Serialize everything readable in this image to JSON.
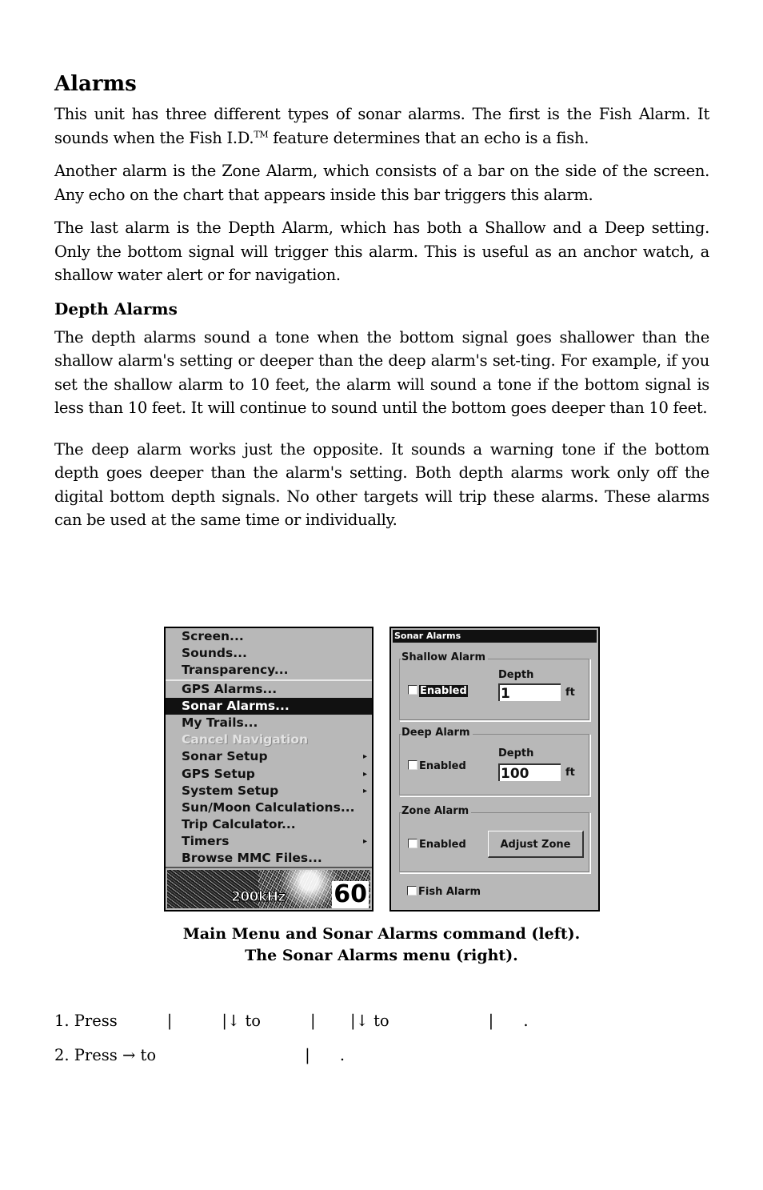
{
  "section_title": "Alarms",
  "paragraphs": {
    "p1_a": "This unit has three different types of sonar alarms. The first is the Fish Alarm. It sounds when the Fish I.D.",
    "p1_tm": "TM",
    "p1_b": " feature determines that an echo is a fish.",
    "p2": "Another alarm is the Zone Alarm, which consists of a bar on the side of the screen. Any echo on the chart that appears inside this bar triggers this alarm.",
    "p3": "The last alarm is the Depth Alarm, which has both a Shallow and a Deep setting. Only the bottom signal will trigger this alarm. This is useful as an anchor watch, a shallow water alert or for navigation.",
    "subheading": "Depth Alarms",
    "p4": "The depth alarms sound a tone when the bottom signal goes shallower than the shallow alarm's setting or deeper than the deep alarm's set-ting. For example, if you set the shallow alarm to 10 feet, the alarm will sound a tone if the bottom signal is less than 10 feet. It will continue to sound until the bottom goes deeper than 10 feet.",
    "p5": "The deep alarm works just the opposite. It sounds a warning tone if the bottom depth goes deeper than the alarm's setting. Both depth alarms work only off the digital bottom depth signals. No other targets will trip these alarms. These alarms can be used at the same time or individually."
  },
  "main_menu": {
    "items": [
      {
        "label": "Screen...",
        "state": "normal"
      },
      {
        "label": "Sounds...",
        "state": "normal"
      },
      {
        "label": "Transparency...",
        "state": "normal"
      },
      {
        "label": "GPS Alarms...",
        "state": "normal"
      },
      {
        "label": "Sonar Alarms...",
        "state": "selected"
      },
      {
        "label": "My Trails...",
        "state": "normal"
      },
      {
        "label": "Cancel Navigation",
        "state": "disabled"
      },
      {
        "label": "Sonar Setup",
        "state": "submenu"
      },
      {
        "label": "GPS Setup",
        "state": "submenu"
      },
      {
        "label": "System Setup",
        "state": "submenu"
      },
      {
        "label": "Sun/Moon Calculations...",
        "state": "normal"
      },
      {
        "label": "Trip Calculator...",
        "state": "normal"
      },
      {
        "label": "Timers",
        "state": "submenu"
      },
      {
        "label": "Browse MMC Files...",
        "state": "normal"
      }
    ],
    "submenu_arrow": "▸",
    "frequency": "200kHz",
    "depth_readout": "60"
  },
  "sonar_alarms": {
    "title": "Sonar Alarms",
    "shallow": {
      "group_label": "Shallow Alarm",
      "enabled_label": "Enabled",
      "enabled": false,
      "depth_label": "Depth",
      "depth_value": "1",
      "unit": "ft"
    },
    "deep": {
      "group_label": "Deep Alarm",
      "enabled_label": "Enabled",
      "enabled": false,
      "depth_label": "Depth",
      "depth_value": "100",
      "unit": "ft"
    },
    "zone": {
      "group_label": "Zone Alarm",
      "enabled_label": "Enabled",
      "enabled": false,
      "button_label": "Adjust Zone"
    },
    "fish": {
      "label": "Fish Alarm",
      "enabled": false
    }
  },
  "caption": {
    "line1": "Main Menu and Sonar Alarms command (left).",
    "line2": "The Sonar Alarms menu (right)."
  },
  "steps": {
    "step1": "1. Press          |          |↓ to          |       |↓ to                    |      .",
    "step2": "2. Press → to                              |      ."
  }
}
